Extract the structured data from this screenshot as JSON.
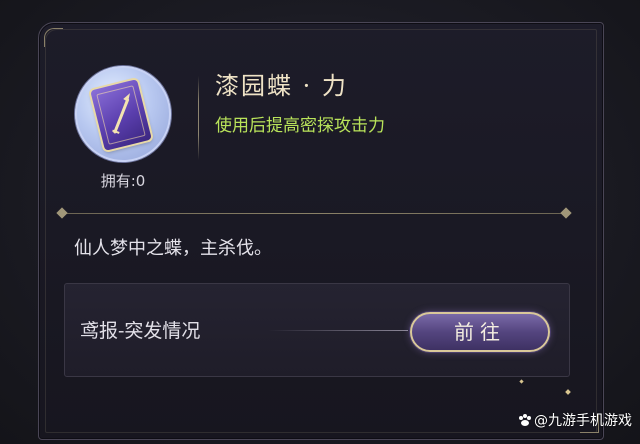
{
  "item": {
    "name": "漆园蝶 · 力",
    "effect": "使用后提高密探攻击力",
    "owned": "拥有:0",
    "description": "仙人梦中之蝶，主杀伐。",
    "icon": "butterfly-card-icon"
  },
  "source": {
    "label": "鸢报-突发情况",
    "go_button": "前往"
  },
  "watermark": {
    "text": "@九游手机游戏"
  },
  "colors": {
    "title": "#efe3c6",
    "effect": "#b9e35a",
    "button_border": "#d9c89a",
    "button_fill": "#54457f"
  }
}
